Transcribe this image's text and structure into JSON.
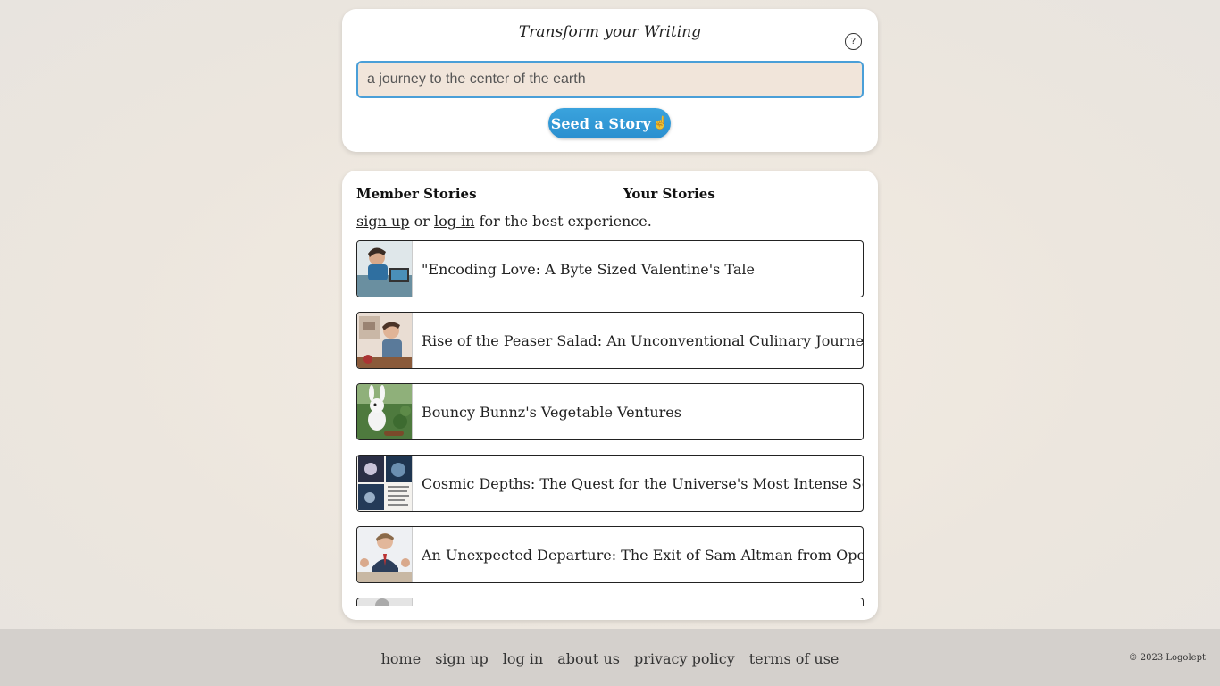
{
  "header": {
    "title": "Transform your Writing",
    "help_label": "?"
  },
  "seed": {
    "input_value": "a journey to the center of the earth",
    "button_label": "Seed a Story"
  },
  "tabs": {
    "member": "Member Stories",
    "yours": "Your Stories"
  },
  "notice": {
    "sign_up": "sign up",
    "or": "or",
    "log_in": "log in",
    "suffix": "for the best experience."
  },
  "stories": [
    {
      "title": "\"Encoding Love: A Byte Sized Valentine's Tale",
      "thumb": "man-at-laptop-illustration"
    },
    {
      "title": "Rise of the Peaser Salad: An Unconventional Culinary Journey",
      "thumb": "man-thinking-illustration"
    },
    {
      "title": "Bouncy Bunnz's Vegetable Ventures",
      "thumb": "white-bunny-garden-illustration"
    },
    {
      "title": "Cosmic Depths: The Quest for the Universe's Most Intense Soup",
      "thumb": "cosmic-collage-illustration"
    },
    {
      "title": "An Unexpected Departure: The Exit of Sam Altman from OpenAI",
      "thumb": "man-in-suit-meeting-illustration"
    }
  ],
  "footer": {
    "links": [
      "home",
      "sign up",
      "log in",
      "about us",
      "privacy policy",
      "terms of use"
    ],
    "copyright": "© 2023 Logolept"
  },
  "colors": {
    "accent": "#2b8fcf",
    "input_bg": "#f1e5da",
    "footer_bg": "#d4d0cc"
  }
}
